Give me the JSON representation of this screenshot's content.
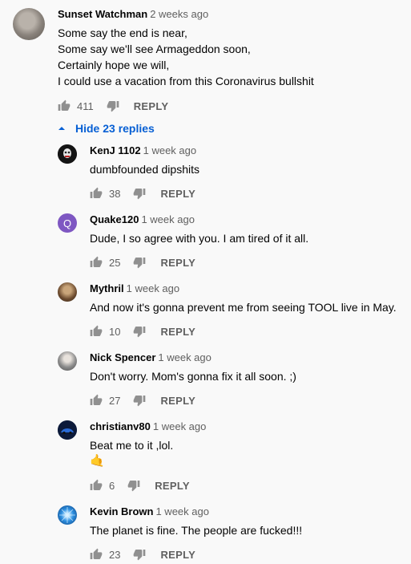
{
  "main_comment": {
    "author": "Sunset Watchman",
    "time": "2 weeks ago",
    "text": "Some say the end is near,\nSome say we'll see Armageddon soon,\nCertainly hope we will,\nI could use a vacation from this Coronavirus bullshit",
    "likes": "411",
    "reply_label": "REPLY"
  },
  "hide_replies_label": "Hide 23 replies",
  "replies": [
    {
      "author": "KenJ 1102",
      "time": "1 week ago",
      "text": "dumbfounded dipshits",
      "likes": "38",
      "reply_label": "REPLY",
      "avatar": "dark-mask-avatar"
    },
    {
      "author": "Quake120",
      "time": "1 week ago",
      "text": "Dude, I so agree with you. I am tired of it all.",
      "likes": "25",
      "reply_label": "REPLY",
      "avatar_letter": "Q",
      "avatar_color": "#7e57c2"
    },
    {
      "author": "Mythril",
      "time": "1 week ago",
      "text": "And now it's gonna prevent me from seeing TOOL live in May.",
      "likes": "10",
      "reply_label": "REPLY",
      "avatar": "photo-avatar"
    },
    {
      "author": "Nick Spencer",
      "time": "1 week ago",
      "text": "Don't worry. Mom's gonna fix it all soon. ;)",
      "likes": "27",
      "reply_label": "REPLY",
      "avatar": "photo-avatar"
    },
    {
      "author": "christianv80",
      "time": "1 week ago",
      "text": "Beat me to it ,lol.",
      "emoji": "🤙",
      "likes": "6",
      "reply_label": "REPLY",
      "avatar": "car-avatar"
    },
    {
      "author": "Kevin Brown",
      "time": "1 week ago",
      "text": "The planet is fine. The people are fucked!!!",
      "likes": "23",
      "reply_label": "REPLY",
      "avatar": "blue-burst-avatar"
    }
  ],
  "colors": {
    "link_blue": "#065fd4",
    "meta_gray": "#606060",
    "background": "#f9f9f9"
  }
}
